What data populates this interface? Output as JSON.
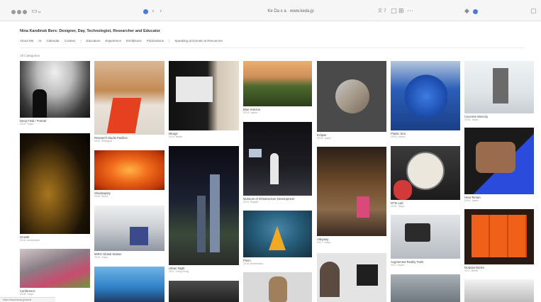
{
  "browser": {
    "url": "Ke Da x a · www.keda.jp",
    "tab_count": "7",
    "accent_color": "#4a7bd8"
  },
  "site": {
    "title": "Nina Kandinsk Bers: Designer, Day, Technologist, Researcher and Educator",
    "nav": [
      "About Me",
      "AI",
      "Calendar",
      "Contact",
      "Education",
      "Experience",
      "Exhibitions",
      "Publications",
      "Speaking at Domain & Resources"
    ],
    "section_label": "All Categories"
  },
  "grid": {
    "col1": [
      {
        "caption": "Deep Field / Portrait",
        "sub": "2019, Tokyo"
      },
      {
        "caption": "Growth",
        "sub": "2018, Amsterdam"
      },
      {
        "caption": "Conference",
        "sub": "2016, Tokyo"
      }
    ],
    "col2": [
      {
        "caption": "Research Studio Pavilion",
        "sub": "2020, Shanghai"
      },
      {
        "caption": "Shadowplay",
        "sub": "2020, Seoul"
      },
      {
        "caption": "MIRG Global Station",
        "sub": "2018, Tokyo"
      },
      {
        "caption": "",
        "sub": ""
      }
    ],
    "col3": [
      {
        "caption": "Mirage",
        "sub": "2019, Berlin"
      },
      {
        "caption": "Urban Night",
        "sub": "2017, Hong Kong"
      },
      {
        "caption": "",
        "sub": ""
      }
    ],
    "col4": [
      {
        "caption": "Blue Horizon",
        "sub": "2019, Japan"
      },
      {
        "caption": "Museum of Infrastructure Development",
        "sub": "2019, Riyadh"
      },
      {
        "caption": "Prism",
        "sub": "2018, Amsterdam"
      },
      {
        "caption": "",
        "sub": ""
      }
    ],
    "col5": [
      {
        "caption": "Eclipse",
        "sub": "2018, Japan"
      },
      {
        "caption": "Alleyway",
        "sub": "2017, Tokyo"
      },
      {
        "caption": "",
        "sub": ""
      }
    ],
    "col6": [
      {
        "caption": "Plastic Sea",
        "sub": "2019, Lisbon"
      },
      {
        "caption": "NTSI Lab",
        "sub": "2018, Tokyo"
      },
      {
        "caption": "Augmented Reality Tools",
        "sub": "2017, Kyoto"
      },
      {
        "caption": "",
        "sub": ""
      }
    ],
    "col7": [
      {
        "caption": "Concrete Memory",
        "sub": "2016, Japan"
      },
      {
        "caption": "Heat Terrain",
        "sub": "2018, Japan"
      },
      {
        "caption": "Modular Bricks",
        "sub": "2017, Berlin"
      },
      {
        "caption": "",
        "sub": ""
      }
    ]
  },
  "status_bar": "https://www.keda.jp/work/"
}
